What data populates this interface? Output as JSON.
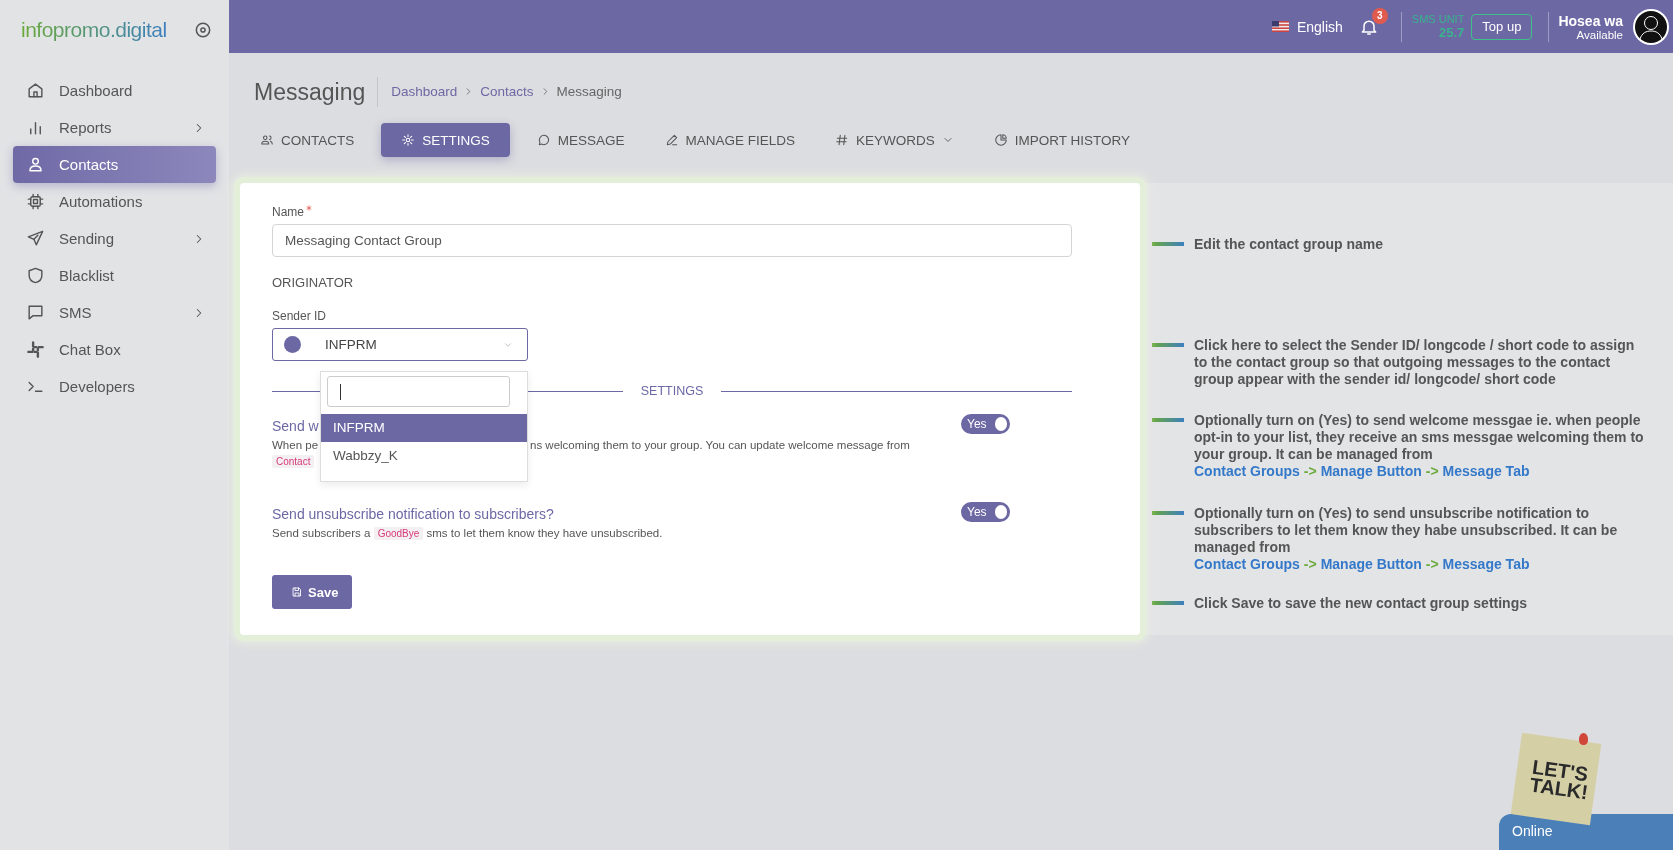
{
  "sidebar": {
    "logo": "infopromo.digital",
    "items": [
      {
        "label": "Dashboard",
        "has_submenu": false,
        "selected": false
      },
      {
        "label": "Reports",
        "has_submenu": true,
        "selected": false
      },
      {
        "label": "Contacts",
        "has_submenu": false,
        "selected": true
      },
      {
        "label": "Automations",
        "has_submenu": false,
        "selected": false
      },
      {
        "label": "Sending",
        "has_submenu": true,
        "selected": false
      },
      {
        "label": "Blacklist",
        "has_submenu": false,
        "selected": false
      },
      {
        "label": "SMS",
        "has_submenu": true,
        "selected": false
      },
      {
        "label": "Chat Box",
        "has_submenu": false,
        "selected": false
      },
      {
        "label": "Developers",
        "has_submenu": false,
        "selected": false
      }
    ]
  },
  "topbar": {
    "language": "English",
    "notification_count": "3",
    "sms_unit_label": "SMS UNIT",
    "sms_unit_value": "25.7",
    "top_up": "Top up",
    "user_name": "Hosea wa",
    "user_status": "Available"
  },
  "page": {
    "title": "Messaging",
    "breadcrumb": [
      "Dashboard",
      "Contacts",
      "Messaging"
    ]
  },
  "tabs": [
    {
      "label": "CONTACTS",
      "selected": false,
      "has_dropdown": false
    },
    {
      "label": "SETTINGS",
      "selected": true,
      "has_dropdown": false
    },
    {
      "label": "MESSAGE",
      "selected": false,
      "has_dropdown": false
    },
    {
      "label": "MANAGE FIELDS",
      "selected": false,
      "has_dropdown": false
    },
    {
      "label": "KEYWORDS",
      "selected": false,
      "has_dropdown": true
    },
    {
      "label": "IMPORT HISTORY",
      "selected": false,
      "has_dropdown": false
    }
  ],
  "form": {
    "name_label": "Name",
    "name_required": true,
    "name_value": "Messaging Contact Group",
    "originator_heading": "ORIGINATOR",
    "sender_label": "Sender ID",
    "sender_value": "INFPRM",
    "dropdown": {
      "options": [
        {
          "label": "INFPRM",
          "selected": true
        },
        {
          "label": "Wabbzy_K",
          "selected": false
        }
      ]
    },
    "settings_heading": "SETTINGS",
    "options": [
      {
        "title": "Send w",
        "description_parts": [
          "When pe",
          "ns welcoming them to your group. You can update welcome message from"
        ],
        "tags": [
          "Contact"
        ],
        "on": true,
        "toggle_label": "Yes"
      },
      {
        "title": "Send unsubscribe notification to subscribers?",
        "description_before": "Send subscribers a",
        "description_tag": "GoodBye",
        "description_after": "sms to let them know they have unsubscribed.",
        "on": true,
        "toggle_label": "Yes"
      }
    ],
    "save_button": "Save"
  },
  "help_notes": [
    {
      "text": "Edit the contact group name"
    },
    {
      "text": "Click here to select the Sender ID/ longcode / short code to assign to the contact group so that outgoing messages to the contact group appear with the sender id/ longcode/ short code"
    },
    {
      "text": "Optionally turn on (Yes) to send welcome messgae ie. when people opt-in to your list, they receive an sms messgae welcoming them to your group. It can be managed from",
      "links": [
        "Contact Groups",
        "Manage Button",
        "Message Tab"
      ],
      "separator": "->"
    },
    {
      "text": "Optionally turn on (Yes) to send unsubscribe notification to subscribers to let them know they habe unsubscribed. It can be managed from",
      "links": [
        "Contact Groups",
        "Manage Button",
        "Message Tab"
      ],
      "separator": "->"
    },
    {
      "text": "Click Save to save the new contact group settings"
    }
  ],
  "chat": {
    "sticker_text": "LET'S TALK!",
    "status": "Online"
  }
}
